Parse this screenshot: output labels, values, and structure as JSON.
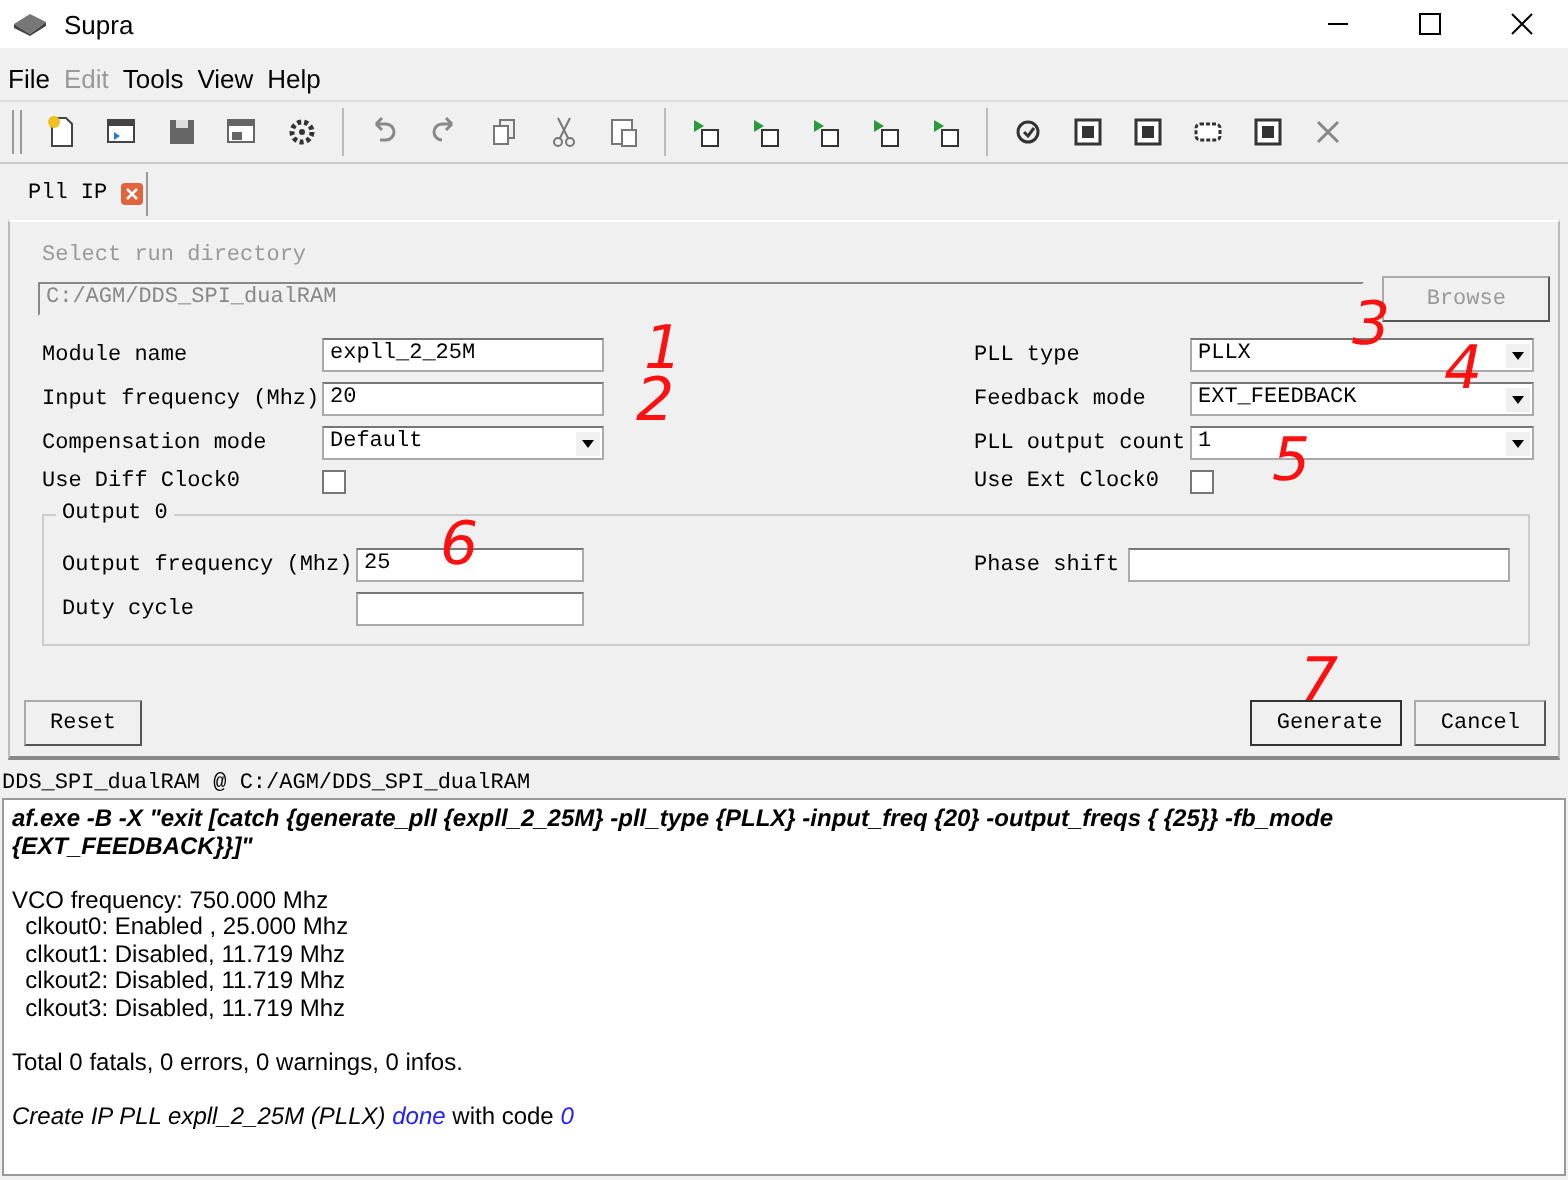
{
  "window": {
    "title": "Supra"
  },
  "menu": [
    {
      "label": "File",
      "disabled": false
    },
    {
      "label": "Edit",
      "disabled": true
    },
    {
      "label": "Tools",
      "disabled": false
    },
    {
      "label": "View",
      "disabled": false
    },
    {
      "label": "Help",
      "disabled": false
    }
  ],
  "tabs": [
    {
      "label": "Pll IP",
      "selected": true
    }
  ],
  "run_directory": {
    "label": "Select run directory",
    "value": "C:/AGM/DDS_SPI_dualRAM",
    "button": "Browse",
    "disabled": true
  },
  "form_rows": [
    {
      "left": {
        "label": "Module name",
        "kind": "text",
        "value": "expll_2_25M"
      },
      "right": {
        "label": "PLL type",
        "kind": "select",
        "value": "PLLX"
      }
    },
    {
      "left": {
        "label": "Input frequency (Mhz)",
        "kind": "text",
        "value": "20"
      },
      "right": {
        "label": "Feedback mode",
        "kind": "select",
        "value": "EXT_FEEDBACK"
      }
    },
    {
      "left": {
        "label": "Compensation mode",
        "kind": "select",
        "value": "Default"
      },
      "right": {
        "label": "PLL output count",
        "kind": "select",
        "value": "1"
      }
    },
    {
      "left": {
        "label": "Use Diff Clock0",
        "kind": "checkbox",
        "checked": false
      },
      "right": {
        "label": "Use Ext Clock0",
        "kind": "checkbox",
        "checked": false
      }
    }
  ],
  "output_group": {
    "title": "Output 0",
    "rows": [
      {
        "left": {
          "label": "Output frequency (Mhz)",
          "kind": "text",
          "value": "25"
        },
        "right": {
          "label": "Phase shift",
          "kind": "text"
        }
      },
      {
        "left": {
          "label": "Duty cycle",
          "kind": "text"
        }
      }
    ]
  },
  "buttons": {
    "reset": "Reset",
    "generate": "Generate",
    "cancel": "Cancel"
  },
  "status_line": "DDS_SPI_dualRAM @ C:/AGM/DDS_SPI_dualRAM",
  "console": [
    {
      "kind": "command",
      "text": "af.exe -B -X \"exit [catch {generate_pll {expll_2_25M} -pll_type {PLLX} -input_freq {20} -output_freqs { {25}} -fb_mode {EXT_FEEDBACK}}]\""
    },
    {
      "kind": "plain",
      "lines": [
        "VCO frequency: 750.000 Mhz",
        "  clkout0: Enabled , 25.000 Mhz",
        "  clkout1: Disabled, 11.719 Mhz",
        "  clkout2: Disabled, 11.719 Mhz",
        "  clkout3: Disabled, 11.719 Mhz"
      ]
    },
    {
      "kind": "plain",
      "lines": [
        "Total 0 fatals, 0 errors, 0 warnings, 0 infos."
      ]
    },
    {
      "kind": "result",
      "parts": [
        {
          "kind": "italic",
          "text": "Create IP PLL expll_2_25M (PLLX) "
        },
        {
          "kind": "link",
          "text": "done"
        },
        {
          "kind": "plain",
          "text": " with code "
        },
        {
          "kind": "link",
          "text": "0"
        }
      ]
    }
  ],
  "annotations": [
    "1",
    "2",
    "3",
    "4",
    "5",
    "6",
    "7"
  ]
}
